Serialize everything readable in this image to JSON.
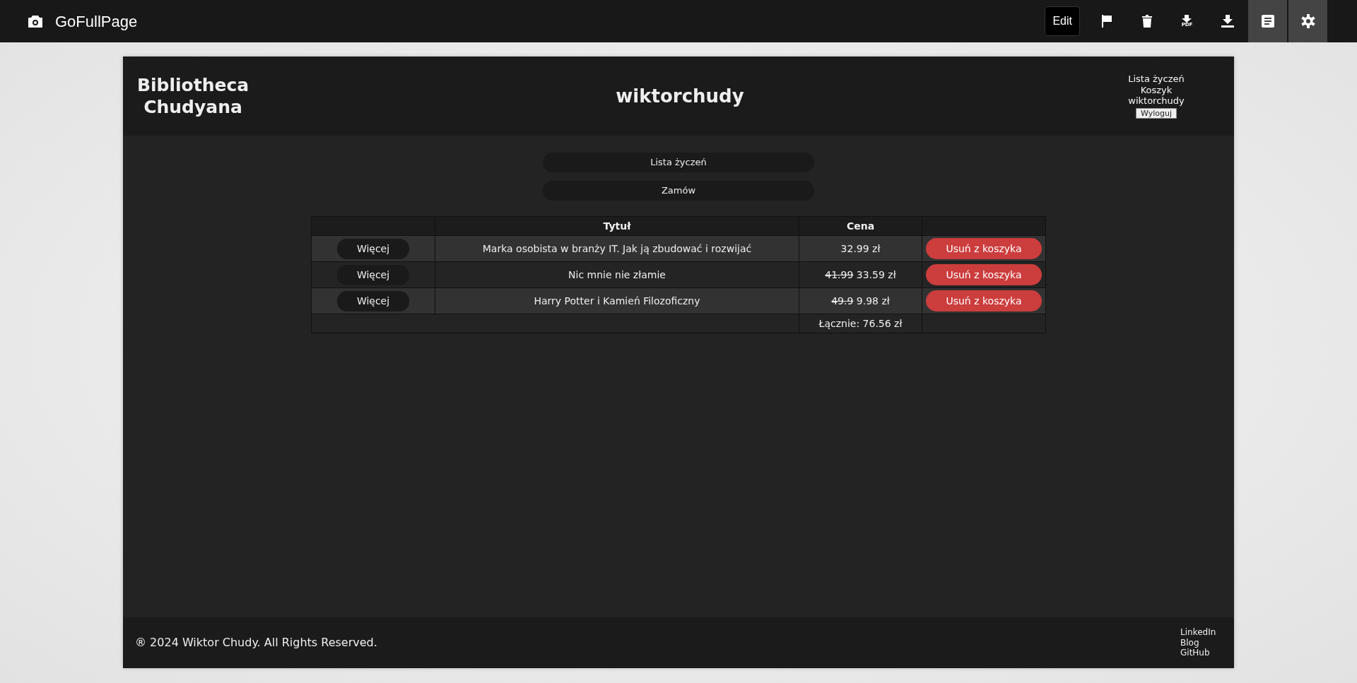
{
  "app_bar": {
    "title": "GoFullPage",
    "edit_label": "Edit",
    "tools": [
      {
        "kind": "flag",
        "selected": false
      },
      {
        "kind": "trash",
        "selected": false
      },
      {
        "kind": "pdf",
        "label": "PDF",
        "selected": false
      },
      {
        "kind": "download",
        "selected": false
      },
      {
        "kind": "document",
        "selected": true
      },
      {
        "kind": "gear",
        "selected": true
      }
    ]
  },
  "site": {
    "brand": "Bibliotheca Chudyana",
    "heading": "wiktorchudy",
    "user_menu": [
      "Lista życzeń",
      "Koszyk",
      "wiktorchudy"
    ],
    "logout": "Wyloguj",
    "actions": [
      "Lista życzeń",
      "Zamów"
    ],
    "table": {
      "columns": [
        "",
        "Tytuł",
        "Cena",
        ""
      ],
      "rows": [
        {
          "more": "Więcej",
          "title": "Marka osobista w branży IT. Jak ją zbudować i rozwijać",
          "price": "32.99 zł",
          "remove": "Usuń z koszyka"
        },
        {
          "more": "Więcej",
          "title": "Nic mnie nie złamie",
          "old_price": "41.99",
          "price": "33.59 zł",
          "remove": "Usuń z koszyka"
        },
        {
          "more": "Więcej",
          "title": "Harry Potter i Kamień Filozoficzny",
          "old_price": "49.9",
          "price": "9.98 zł",
          "remove": "Usuń z koszyka"
        }
      ],
      "total": "Łącznie: 76.56 zł"
    },
    "footer": {
      "copyright": "® 2024 Wiktor Chudy. All Rights Reserved.",
      "links": [
        "LinkedIn",
        "Blog",
        "GitHub"
      ]
    }
  }
}
